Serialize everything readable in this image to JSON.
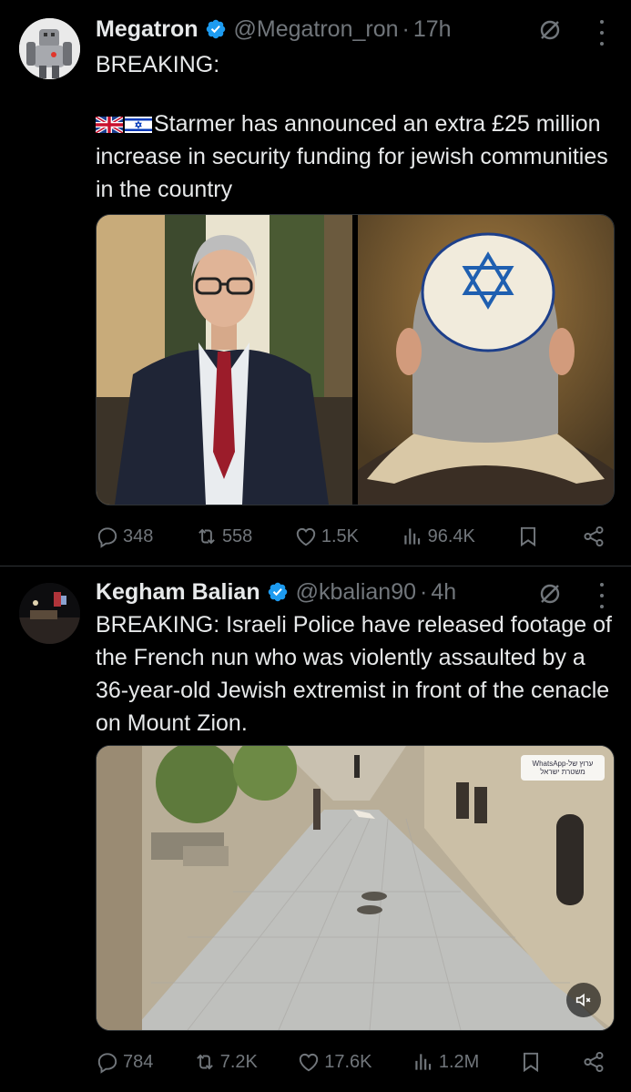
{
  "tweets": [
    {
      "author_name": "Megatron",
      "handle": "@Megatron_ron",
      "time": "17h",
      "text_line1": "BREAKING:",
      "text_body": "Starmer has announced an extra £25 million increase in security funding for jewish communities in the country",
      "flags": [
        "uk-flag-icon",
        "israel-flag-icon"
      ],
      "stats": {
        "replies": "348",
        "reposts": "558",
        "likes": "1.5K",
        "views": "96.4K"
      }
    },
    {
      "author_name": "Kegham Balian",
      "handle": "@kbalian90",
      "time": "4h",
      "text_body": "BREAKING: Israeli Police have released footage of the French nun who was violently assaulted by a 36-year-old Jewish extremist in front of the cenacle on Mount Zion.",
      "video_badge": "WhatsApp-ערוץ של משטרת ישראל",
      "stats": {
        "replies": "784",
        "reposts": "7.2K",
        "likes": "17.6K",
        "views": "1.2M"
      }
    }
  ],
  "colors": {
    "background": "#000000",
    "text": "#e7e9ea",
    "muted": "#71767b",
    "verified": "#1d9bf0",
    "divider": "#2f3336"
  }
}
